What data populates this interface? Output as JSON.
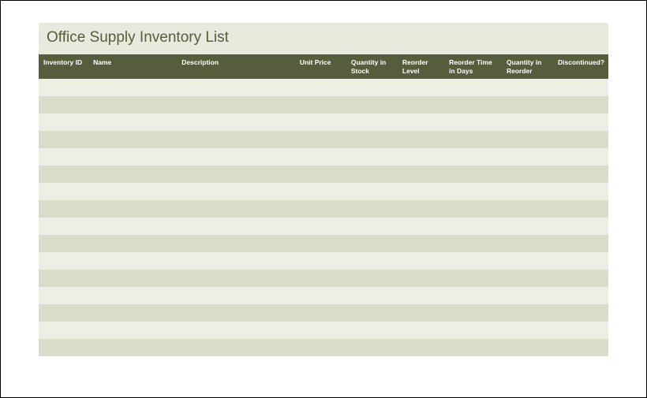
{
  "title": "Office Supply Inventory List",
  "columns": [
    "Inventory ID",
    "Name",
    "Description",
    "Unit Price",
    "Quantity in Stock",
    "Reorder Level",
    "Reorder Time in Days",
    "Quantity in Reorder",
    "Discontinued?"
  ],
  "rows": [
    [
      "",
      "",
      "",
      "",
      "",
      "",
      "",
      "",
      ""
    ],
    [
      "",
      "",
      "",
      "",
      "",
      "",
      "",
      "",
      ""
    ],
    [
      "",
      "",
      "",
      "",
      "",
      "",
      "",
      "",
      ""
    ],
    [
      "",
      "",
      "",
      "",
      "",
      "",
      "",
      "",
      ""
    ],
    [
      "",
      "",
      "",
      "",
      "",
      "",
      "",
      "",
      ""
    ],
    [
      "",
      "",
      "",
      "",
      "",
      "",
      "",
      "",
      ""
    ],
    [
      "",
      "",
      "",
      "",
      "",
      "",
      "",
      "",
      ""
    ],
    [
      "",
      "",
      "",
      "",
      "",
      "",
      "",
      "",
      ""
    ],
    [
      "",
      "",
      "",
      "",
      "",
      "",
      "",
      "",
      ""
    ],
    [
      "",
      "",
      "",
      "",
      "",
      "",
      "",
      "",
      ""
    ],
    [
      "",
      "",
      "",
      "",
      "",
      "",
      "",
      "",
      ""
    ],
    [
      "",
      "",
      "",
      "",
      "",
      "",
      "",
      "",
      ""
    ],
    [
      "",
      "",
      "",
      "",
      "",
      "",
      "",
      "",
      ""
    ],
    [
      "",
      "",
      "",
      "",
      "",
      "",
      "",
      "",
      ""
    ],
    [
      "",
      "",
      "",
      "",
      "",
      "",
      "",
      "",
      ""
    ],
    [
      "",
      "",
      "",
      "",
      "",
      "",
      "",
      "",
      ""
    ]
  ]
}
